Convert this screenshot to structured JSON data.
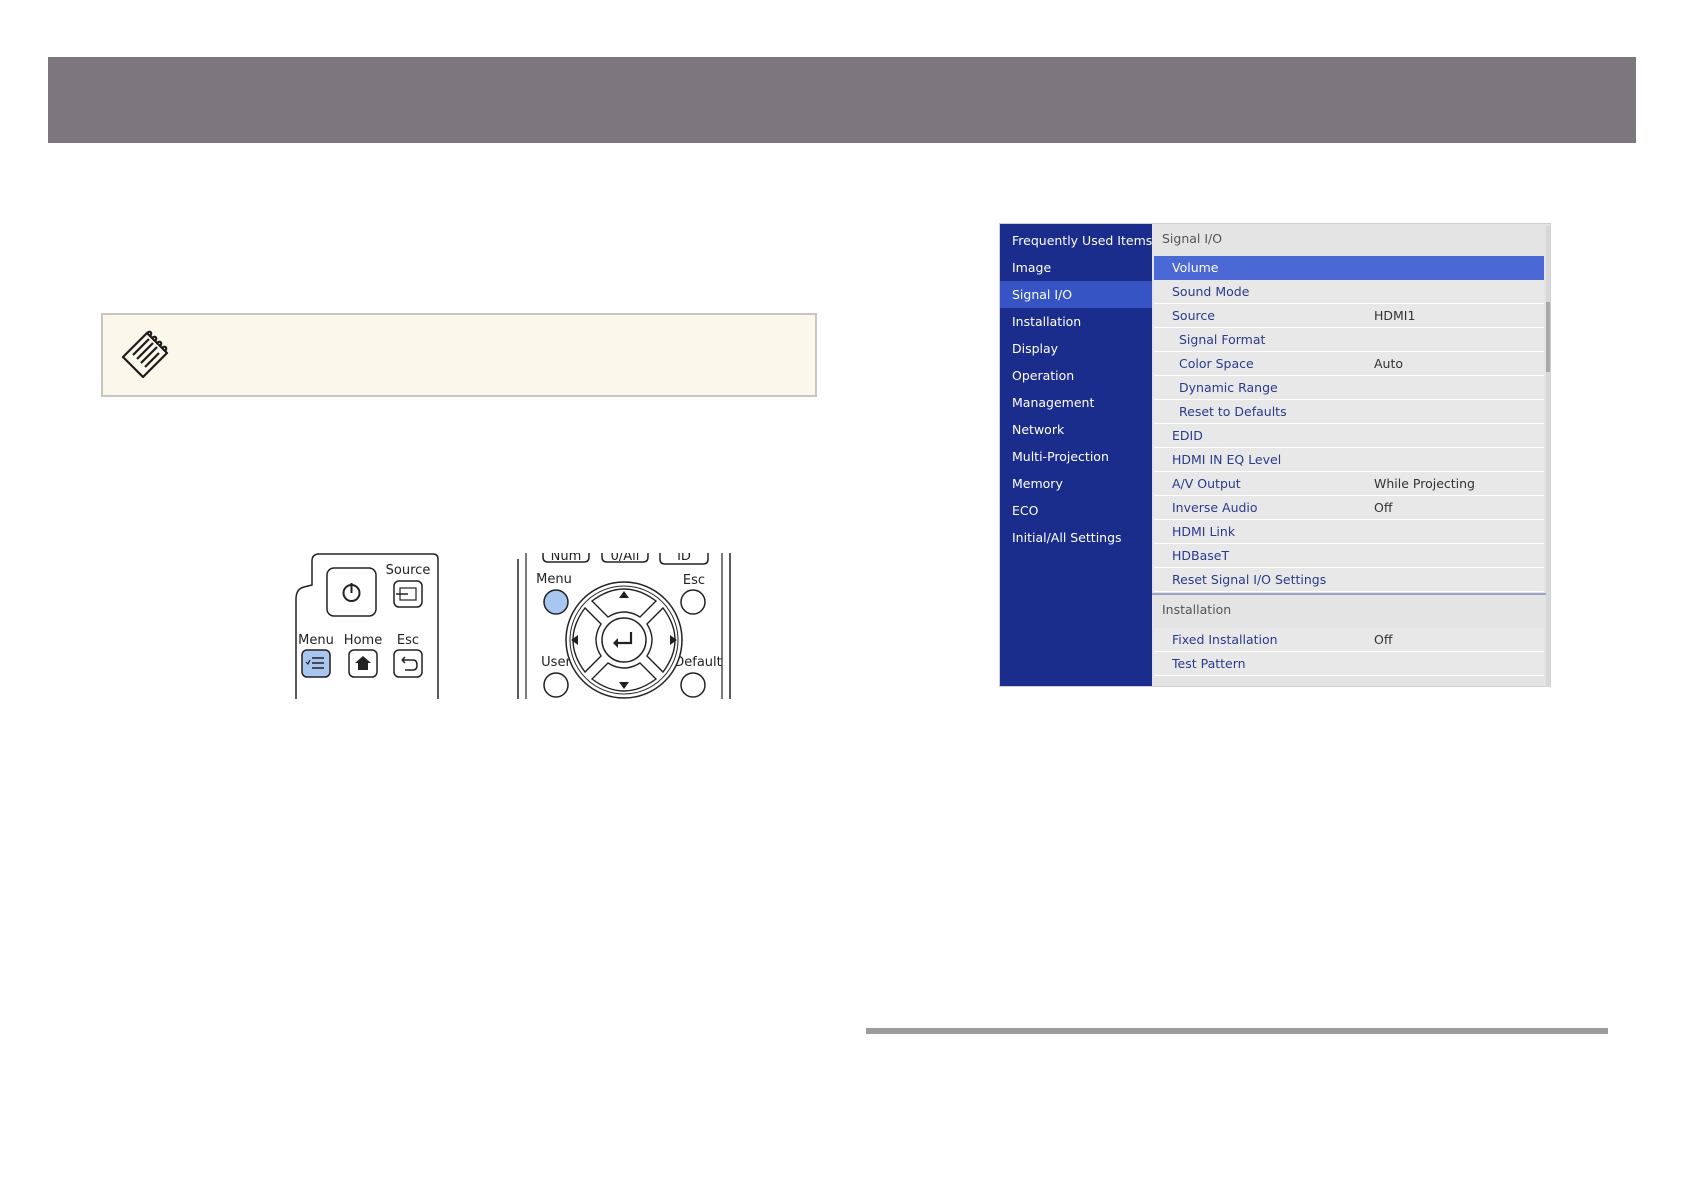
{
  "remote_left": {
    "source_label": "Source",
    "menu_label": "Menu",
    "home_label": "Home",
    "esc_label": "Esc"
  },
  "remote_right": {
    "top_keys": [
      "Num",
      "0/All",
      "ID"
    ],
    "menu_label": "Menu",
    "esc_label": "Esc",
    "user_label": "User",
    "default_label": "Default"
  },
  "osd": {
    "sidebar": [
      {
        "label": "Frequently Used Items",
        "active": false
      },
      {
        "label": "Image",
        "active": false
      },
      {
        "label": "Signal I/O",
        "active": true
      },
      {
        "label": "Installation",
        "active": false
      },
      {
        "label": "Display",
        "active": false
      },
      {
        "label": "Operation",
        "active": false
      },
      {
        "label": "Management",
        "active": false
      },
      {
        "label": "Network",
        "active": false
      },
      {
        "label": "Multi-Projection",
        "active": false
      },
      {
        "label": "Memory",
        "active": false
      },
      {
        "label": "ECO",
        "active": false
      },
      {
        "label": "Initial/All Settings",
        "active": false
      }
    ],
    "signal_section": {
      "title": "Signal I/O",
      "rows": [
        {
          "label": "Volume",
          "value": "",
          "sub": false,
          "selected": true
        },
        {
          "label": "Sound Mode",
          "value": "",
          "sub": false,
          "selected": false
        },
        {
          "label": "Source",
          "value": "HDMI1",
          "sub": false,
          "selected": false
        },
        {
          "label": "Signal Format",
          "value": "",
          "sub": true,
          "selected": false
        },
        {
          "label": "Color Space",
          "value": "Auto",
          "sub": true,
          "selected": false
        },
        {
          "label": "Dynamic Range",
          "value": "",
          "sub": true,
          "selected": false
        },
        {
          "label": "Reset to Defaults",
          "value": "",
          "sub": true,
          "selected": false
        },
        {
          "label": "EDID",
          "value": "",
          "sub": false,
          "selected": false
        },
        {
          "label": "HDMI IN EQ Level",
          "value": "",
          "sub": false,
          "selected": false
        },
        {
          "label": "A/V Output",
          "value": "While Projecting",
          "sub": false,
          "selected": false
        },
        {
          "label": "Inverse Audio",
          "value": "Off",
          "sub": false,
          "selected": false
        },
        {
          "label": "HDMI Link",
          "value": "",
          "sub": false,
          "selected": false
        },
        {
          "label": "HDBaseT",
          "value": "",
          "sub": false,
          "selected": false
        },
        {
          "label": "Reset Signal I/O Settings",
          "value": "",
          "sub": false,
          "selected": false
        }
      ]
    },
    "installation_section": {
      "title": "Installation",
      "rows": [
        {
          "label": "Fixed Installation",
          "value": "Off",
          "sub": false,
          "selected": false
        },
        {
          "label": "Test Pattern",
          "value": "",
          "sub": false,
          "selected": false
        }
      ]
    }
  }
}
